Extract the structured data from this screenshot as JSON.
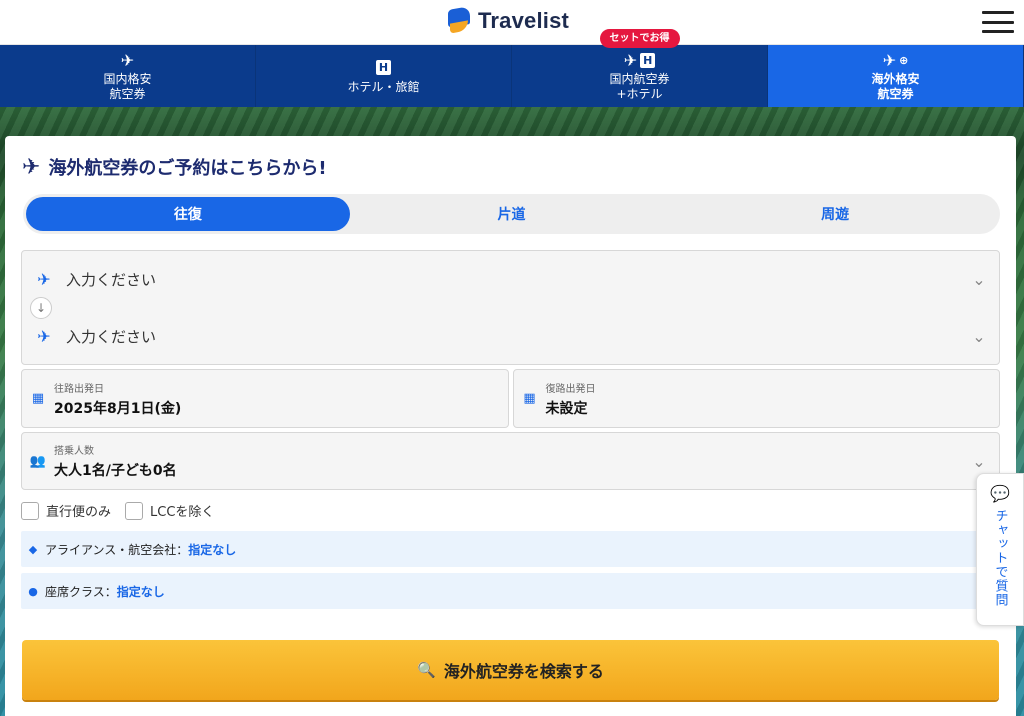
{
  "header": {
    "logo_text": "Travelist"
  },
  "nav": {
    "tabs": [
      {
        "line1": "国内格安",
        "line2": "航空券"
      },
      {
        "line1": "ホテル・旅館"
      },
      {
        "line1": "国内航空券",
        "line2": "+ホテル",
        "badge": "セットでお得"
      },
      {
        "line1": "海外格安",
        "line2": "航空券"
      }
    ]
  },
  "search": {
    "title": "海外航空券のご予約はこちらから!",
    "trip_types": [
      "往復",
      "片道",
      "周遊"
    ],
    "departure_placeholder": "入力ください",
    "arrival_placeholder": "入力ください",
    "outbound_label": "往路出発日",
    "outbound_value": "2025年8月1日(金)",
    "return_label": "復路出発日",
    "return_value": "未設定",
    "pax_label": "搭乗人数",
    "pax_value": "大人1名/子ども0名",
    "direct_only": "直行便のみ",
    "exclude_lcc": "LCCを除く",
    "alliance_label": "アライアンス・航空会社：",
    "alliance_value": "指定なし",
    "seat_label": "座席クラス：",
    "seat_value": "指定なし",
    "button_label": "海外航空券を検索する"
  },
  "chat": {
    "label": "チャットで質問"
  },
  "colors": {
    "nav_bg": "#0b3b8c",
    "accent": "#1967e6",
    "badge": "#e5173f",
    "cta": "#f5b12a"
  }
}
